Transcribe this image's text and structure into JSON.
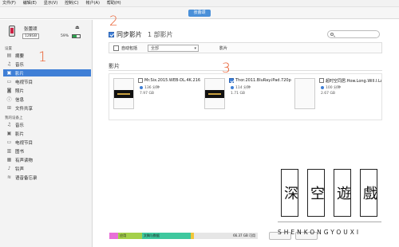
{
  "menu": [
    "文件(F)",
    "编辑(E)",
    "显示(V)",
    "控制(C)",
    "帐户(A)",
    "帮助(H)"
  ],
  "window": {
    "title_pill": "张蕾颂"
  },
  "device": {
    "name": "张蕾颂",
    "capacity": "128GB",
    "battery_pct": "59%",
    "battery_level": 0.59
  },
  "sidebar": {
    "settings_title": "设置",
    "settings": [
      {
        "label": "摘要",
        "icon": "summary-icon"
      },
      {
        "label": "音乐",
        "icon": "music-icon"
      },
      {
        "label": "影片",
        "icon": "film-icon"
      },
      {
        "label": "电视节目",
        "icon": "tv-icon"
      },
      {
        "label": "照片",
        "icon": "camera-icon"
      },
      {
        "label": "信息",
        "icon": "info-icon"
      },
      {
        "label": "文件共享",
        "icon": "apps-icon"
      }
    ],
    "on_device_title": "我的设备上",
    "on_device": [
      {
        "label": "音乐",
        "icon": "music-icon"
      },
      {
        "label": "影片",
        "icon": "film-icon"
      },
      {
        "label": "电视节目",
        "icon": "tv-icon"
      },
      {
        "label": "图书",
        "icon": "book-icon"
      },
      {
        "label": "有声读物",
        "icon": "audiobook-icon"
      },
      {
        "label": "铃声",
        "icon": "bell-icon"
      },
      {
        "label": "语音备忘录",
        "icon": "voice-memo-icon"
      }
    ]
  },
  "main": {
    "sync_label": "同步影片",
    "sync_count": "1 部影片",
    "auto_include_label": "自动包括",
    "auto_include_value": "全部",
    "auto_include_suffix": "影片",
    "section_title": "影片",
    "movies": [
      {
        "title": "Mr.Six.2015.WEB-DL.4K.2160P.H264.AAC-SeeHD",
        "duration": "136 分钟",
        "size": "7.97 GB",
        "checked": false
      },
      {
        "title": "Thor.2011.BluRay.iPad.720p.AAC.x264-CHDPAD",
        "duration": "114 分钟",
        "size": "1.71 GB",
        "checked": true
      },
      {
        "title": "超时空同居.How.Long.Will.I.Love.U.2018",
        "duration": "100 分钟",
        "size": "2.67 GB",
        "checked": false
      }
    ]
  },
  "storage": {
    "segments": [
      {
        "label": "",
        "color": "#e86fd8",
        "fraction": 0.06
      },
      {
        "label": "应用",
        "color": "#a4d04a",
        "fraction": 0.16
      },
      {
        "label": "文稿与数据",
        "color": "#3ec89e",
        "fraction": 0.33
      },
      {
        "label": "",
        "color": "#f2c63a",
        "fraction": 0.02
      },
      {
        "label": "66.37 GB 可用",
        "color": "#e6e6e6",
        "fraction": 0.43
      }
    ]
  },
  "annotations": [
    "1",
    "2",
    "3"
  ],
  "watermark": {
    "glyphs": [
      "深",
      "空",
      "遊",
      "戲"
    ],
    "latin": "SHENKONGYOUXI"
  },
  "colors": {
    "accent": "#3f7fd6",
    "annotation": "#e85a2a"
  }
}
